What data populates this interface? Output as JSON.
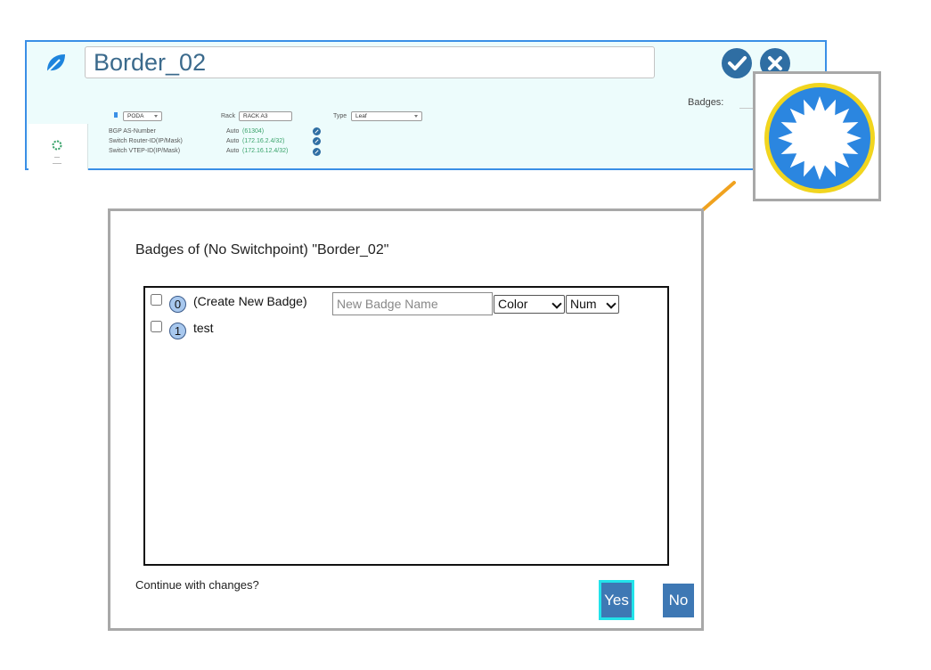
{
  "switch_panel": {
    "name_value": "Border_02",
    "badges_label": "Badges:",
    "pod_select": "PODA",
    "rack_label": "Rack",
    "rack_value": "RACK A3",
    "type_label": "Type",
    "type_select": "Leaf",
    "properties": [
      {
        "label": "BGP AS-Number",
        "mode": "Auto",
        "value": "(61304)"
      },
      {
        "label": "Switch Router-ID(IP/Mask)",
        "mode": "Auto",
        "value": "(172.16.2.4/32)"
      },
      {
        "label": "Switch VTEP-ID(IP/Mask)",
        "mode": "Auto",
        "value": "(172.16.12.4/32)"
      }
    ]
  },
  "zoom": {
    "icon": "badge-starburst-icon",
    "colors": {
      "circle": "#2b86e0",
      "ring": "#f1d51f",
      "star": "#ffffff"
    }
  },
  "dialog": {
    "title": "Badges of (No Switchpoint) \"Border_02\"",
    "badges": [
      {
        "number": "0",
        "label": "(Create New Badge)"
      },
      {
        "number": "1",
        "label": "test"
      }
    ],
    "new_badge_placeholder": "New Badge Name",
    "color_select": "Color",
    "num_select": "Num",
    "continue_text": "Continue with changes?",
    "yes_label": "Yes",
    "no_label": "No"
  },
  "colors": {
    "panel_bg": "#edfcfc",
    "panel_border": "#3a8fe6",
    "button_blue": "#3e78b4",
    "yes_focus": "#22e3ea",
    "arrow": "#f0a21f"
  }
}
